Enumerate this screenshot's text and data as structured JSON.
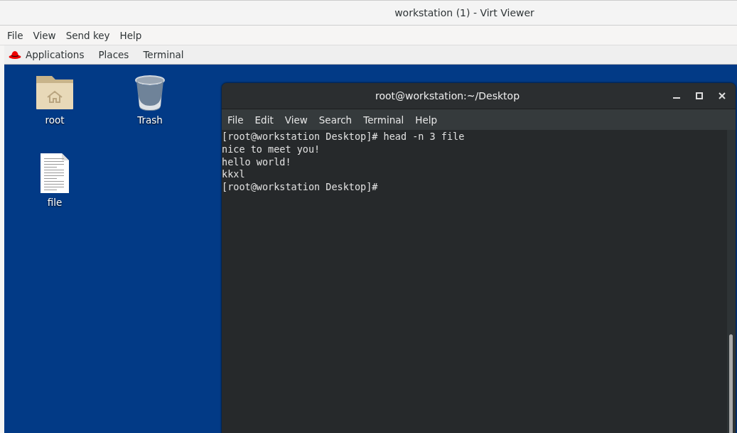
{
  "window": {
    "title": "workstation (1) - Virt Viewer"
  },
  "menu": [
    "File",
    "View",
    "Send key",
    "Help"
  ],
  "panel": {
    "items": [
      "Applications",
      "Places",
      "Terminal"
    ]
  },
  "desktop_icons": [
    {
      "label": "root",
      "kind": "folder"
    },
    {
      "label": "Trash",
      "kind": "trash"
    },
    {
      "label": "file",
      "kind": "document"
    }
  ],
  "terminal": {
    "title": "root@workstation:~/Desktop",
    "menu": [
      "File",
      "Edit",
      "View",
      "Search",
      "Terminal",
      "Help"
    ],
    "lines": [
      "[root@workstation Desktop]# head -n 3 file",
      "nice to meet you!",
      "hello world!",
      "kkxl",
      "[root@workstation Desktop]#"
    ]
  }
}
